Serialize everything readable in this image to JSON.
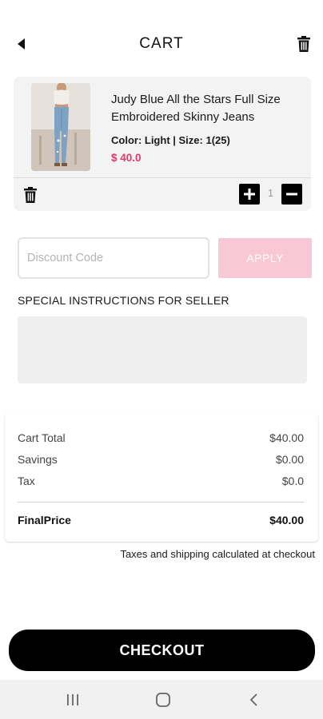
{
  "header": {
    "title": "CART",
    "back_icon": "back-arrow-icon",
    "trash_icon": "trash-icon"
  },
  "cart_item": {
    "name": "Judy Blue All the Stars Full Size Embroidered Skinny Jeans",
    "variant": "Color: Light | Size: 1(25)",
    "price": "$ 40.0",
    "quantity": "1",
    "image": "jeans-product-photo",
    "colors": {
      "price": "#e0386a",
      "card_bg": "#f3f3f3"
    }
  },
  "discount": {
    "placeholder": "Discount Code",
    "value": "",
    "apply_label": "APPLY",
    "apply_color": "#f9c8d6"
  },
  "instructions": {
    "label": "SPECIAL INSTRUCTIONS FOR SELLER",
    "value": ""
  },
  "summary": {
    "rows": [
      {
        "label": "Cart Total",
        "value": "$40.00"
      },
      {
        "label": "Savings",
        "value": "$0.00"
      },
      {
        "label": "Tax",
        "value": "$0.0"
      }
    ],
    "final": {
      "label": "FinalPrice",
      "value": "$40.00"
    }
  },
  "tax_note": "Taxes and shipping calculated at checkout",
  "checkout_label": "CHECKOUT",
  "system_nav": {
    "icons": [
      "recent-apps-icon",
      "home-icon",
      "back-icon"
    ]
  }
}
